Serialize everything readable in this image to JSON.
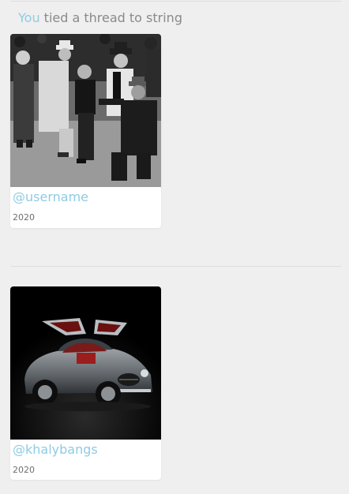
{
  "thread": {
    "actor": "You",
    "action_text": " tied a thread to string"
  },
  "cards": [
    {
      "handle": "@username",
      "year": "2020",
      "image_icon": "black-and-white-photo-crowd-of-men-in-suits-and-hats"
    },
    {
      "handle": "@khalybangs",
      "year": "2020",
      "image_icon": "silver-gullwing-sports-car-photo"
    }
  ],
  "colors": {
    "background": "#efefef",
    "accent": "#8fcbe3",
    "muted_text": "#8a8a8a",
    "card": "#ffffff"
  }
}
